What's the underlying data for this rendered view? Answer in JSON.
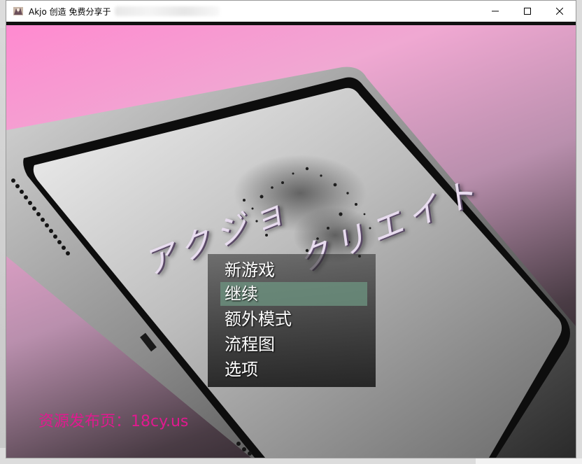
{
  "window": {
    "title": "Akjo 创造 免费分享于",
    "controls": {
      "minimize_icon": "minimize-icon",
      "maximize_icon": "maximize-icon",
      "close_icon": "close-icon"
    }
  },
  "game": {
    "logo_left": "アクジョ",
    "logo_right": "クリエイト",
    "menu": [
      {
        "label": "新游戏",
        "selected": false
      },
      {
        "label": "继续",
        "selected": true
      },
      {
        "label": "额外模式",
        "selected": false
      },
      {
        "label": "流程图",
        "selected": false
      },
      {
        "label": "选项",
        "selected": false
      }
    ],
    "source_text": "资源发布页：18cy.us"
  },
  "colors": {
    "background_top": "#ff8ad0",
    "background_bottom": "#0e0b0d",
    "menu_highlight": "#6e9682",
    "source_text": "#e1198f"
  }
}
